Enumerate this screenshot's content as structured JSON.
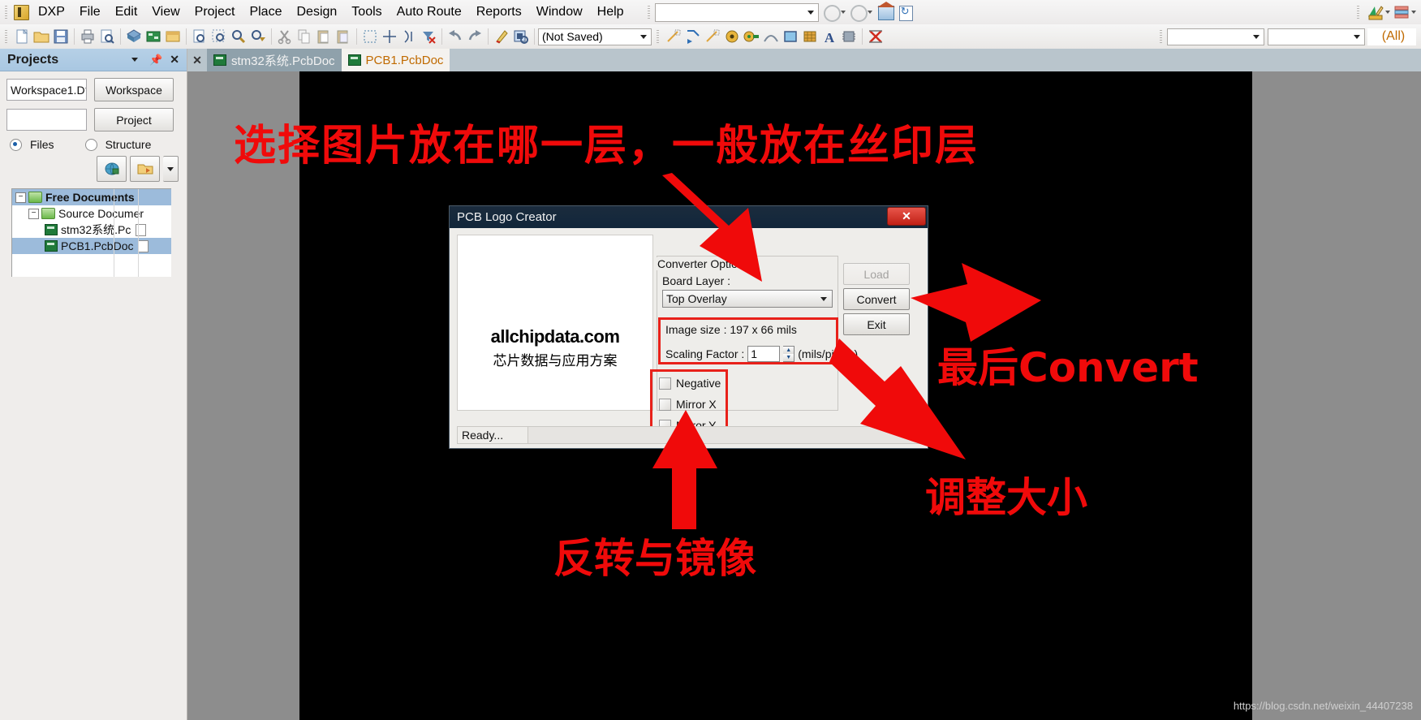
{
  "app": {
    "logo_icon": "dxp-logo-icon",
    "menu": [
      {
        "label": "DXP",
        "key": "X"
      },
      {
        "label": "File",
        "key": "F"
      },
      {
        "label": "Edit",
        "key": "E"
      },
      {
        "label": "View",
        "key": "V"
      },
      {
        "label": "Project",
        "key": "c"
      },
      {
        "label": "Place",
        "key": "P"
      },
      {
        "label": "Design",
        "key": "D"
      },
      {
        "label": "Tools",
        "key": "T"
      },
      {
        "label": "Auto Route",
        "key": "A"
      },
      {
        "label": "Reports",
        "key": "R"
      },
      {
        "label": "Window",
        "key": "W"
      },
      {
        "label": "Help",
        "key": "H"
      }
    ],
    "menubar_search_value": "",
    "nav_icons": [
      "back-icon",
      "forward-icon",
      "home-icon",
      "refresh-icon"
    ],
    "right_icons": [
      "ruler-pencil-icon",
      "layers-icon"
    ]
  },
  "toolbar": {
    "icons": [
      "new-document-icon",
      "open-folder-icon",
      "save-icon",
      "print-icon",
      "print-preview-icon",
      "board-3d-icon",
      "pcb-board-icon",
      "library-icon",
      "zoom-document-icon",
      "zoom-area-icon",
      "zoom-in-icon",
      "zoom-filter-icon",
      "cut-icon",
      "copy-icon",
      "paste-icon",
      "paste-special-icon",
      "select-area-icon",
      "move-icon",
      "align-icon",
      "clear-filter-icon",
      "undo-icon",
      "redo-icon",
      "cross-probe-icon",
      "browse-component-icon"
    ],
    "document_combo_value": "(Not Saved)",
    "draw_icons": [
      "place-line-icon",
      "place-track-icon",
      "place-arc-line-icon",
      "place-via-icon",
      "place-pad-icon",
      "place-arc-icon",
      "place-fill-icon",
      "place-polygon-icon",
      "place-string-icon",
      "place-component-icon",
      "cancel-route-icon"
    ],
    "filter_combo_1_value": "",
    "filter_combo_2_value": "",
    "filter_all_value": "(All)"
  },
  "projects_panel": {
    "title": "Projects",
    "title_icons": [
      "chevron-down-icon",
      "pin-icon",
      "close-icon"
    ],
    "workspace_value": "Workspace1.D",
    "workspace_button": "Workspace",
    "project_value": "",
    "project_button": "Project",
    "view_modes": [
      {
        "label": "Files",
        "selected": true
      },
      {
        "label": "Structure",
        "selected": false
      }
    ],
    "tool_icons": [
      "compile-icon",
      "open-project-icon",
      "dropdown-arrow-icon"
    ],
    "tree": [
      {
        "label": "Free Documents",
        "depth": 0,
        "bold": true,
        "selected_row": true,
        "expander": "-",
        "icon": "folder-icon"
      },
      {
        "label": "Source Documer",
        "depth": 1,
        "bold": false,
        "selected_row": false,
        "expander": "-",
        "icon": "folder-icon"
      },
      {
        "label": "stm32系统.Pc",
        "depth": 2,
        "bold": false,
        "selected_row": false,
        "expander": "",
        "icon": "pcb-doc-icon"
      },
      {
        "label": "PCB1.PcbDoc",
        "depth": 2,
        "bold": false,
        "selected_row": true,
        "expander": "",
        "icon": "pcb-doc-icon"
      }
    ]
  },
  "tabs": [
    {
      "label": "stm32系统.PcbDoc",
      "active": false
    },
    {
      "label": "PCB1.PcbDoc",
      "active": true
    }
  ],
  "dialog": {
    "title": "PCB Logo Creator",
    "close_label": "✕",
    "preview_logo_main": "allchipdata.com",
    "preview_logo_sub": "芯片数据与应用方案",
    "group_legend": "Converter Options",
    "board_layer_label": "Board Layer :",
    "board_layer_value": "Top Overlay",
    "image_size_label": "Image size : 197 x 66 mils",
    "scaling_factor_label": "Scaling Factor :",
    "scaling_factor_value": "1",
    "scaling_units": "(mils/pixels)",
    "checkboxes": [
      {
        "label": "Negative",
        "checked": false
      },
      {
        "label": "Mirror X",
        "checked": false
      },
      {
        "label": "Mirror Y",
        "checked": false
      }
    ],
    "buttons": [
      {
        "label": "Load",
        "enabled": false
      },
      {
        "label": "Convert",
        "enabled": true
      },
      {
        "label": "Exit",
        "enabled": true
      }
    ],
    "status_text": "Ready...",
    "progress_percent": 0
  },
  "annotations": {
    "accent_color": "#f00a0a",
    "top": "选择图片放在哪一层，一般放在丝印层",
    "convert": "最后Convert",
    "size": "调整大小",
    "mirror": "反转与镜像"
  },
  "watermark": "https://blog.csdn.net/weixin_44407238"
}
